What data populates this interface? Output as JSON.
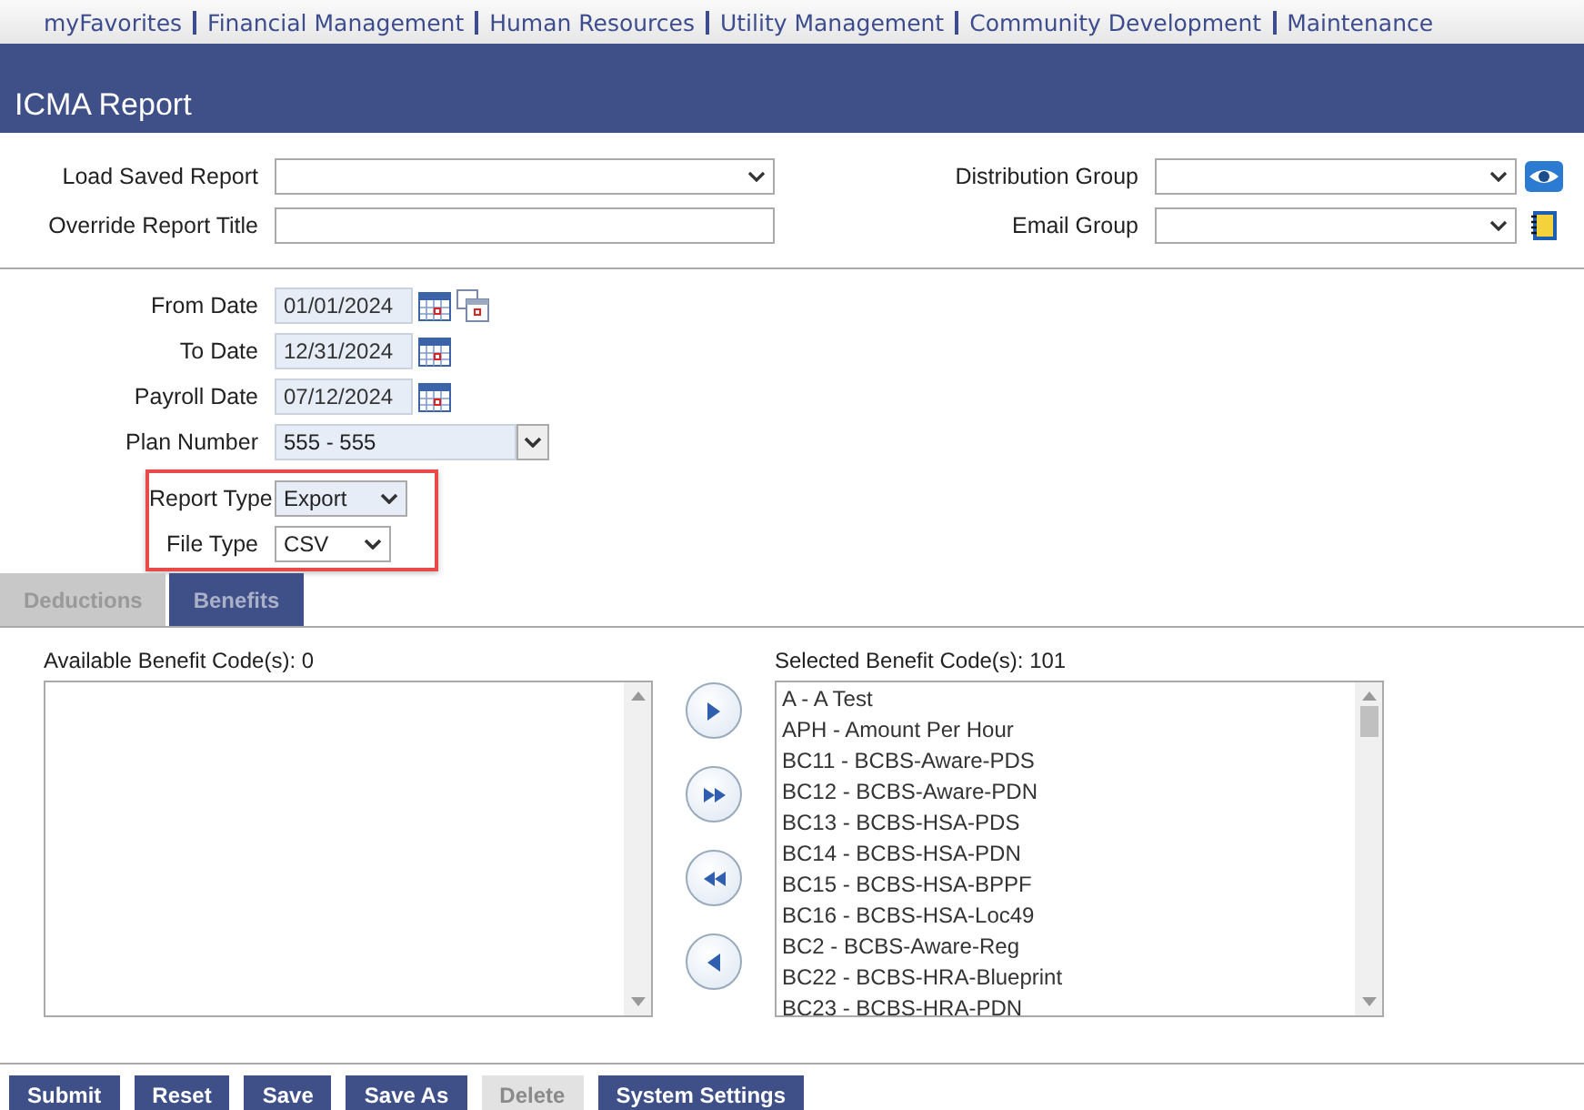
{
  "nav": [
    "myFavorites",
    "Financial Management",
    "Human Resources",
    "Utility Management",
    "Community Development",
    "Maintenance"
  ],
  "title": "ICMA Report",
  "top_left": [
    {
      "label": "Load Saved Report",
      "kind": "select"
    },
    {
      "label": "Override Report Title",
      "kind": "text"
    }
  ],
  "top_right": [
    {
      "label": "Distribution Group"
    },
    {
      "label": "Email Group"
    }
  ],
  "dates": [
    {
      "label": "From Date",
      "value": "01/01/2024"
    },
    {
      "label": "To Date",
      "value": "12/31/2024"
    },
    {
      "label": "Payroll Date",
      "value": "07/12/2024"
    }
  ],
  "plan": {
    "label": "Plan Number",
    "value": "555 - 555"
  },
  "highlighted": [
    {
      "label": "Report Type",
      "value": "Export"
    },
    {
      "label": "File Type",
      "value": "CSV"
    }
  ],
  "tabs": [
    {
      "label": "Deductions",
      "selected": false
    },
    {
      "label": "Benefits",
      "selected": true
    }
  ],
  "available": {
    "label": "Available Benefit Code(s): 0"
  },
  "selected_list": {
    "label": "Selected Benefit Code(s): 101",
    "items": [
      "A - A Test",
      "APH - Amount Per Hour",
      "BC11 - BCBS-Aware-PDS",
      "BC12 - BCBS-Aware-PDN",
      "BC13 - BCBS-HSA-PDS",
      "BC14 - BCBS-HSA-PDN",
      "BC15 - BCBS-HSA-BPPF",
      "BC16 - BCBS-HSA-Loc49",
      "BC2 - BCBS-Aware-Reg",
      "BC22 - BCBS-HRA-Blueprint",
      "BC23 - BCBS-HRA-PDN"
    ]
  },
  "move_buttons": [
    {
      "kind": "right"
    },
    {
      "kind": "all-right"
    },
    {
      "kind": "all-left"
    },
    {
      "kind": "left"
    }
  ],
  "buttons": [
    {
      "label": "Submit",
      "disabled": false
    },
    {
      "label": "Reset",
      "disabled": false
    },
    {
      "label": "Save",
      "disabled": false
    },
    {
      "label": "Save As",
      "disabled": false
    },
    {
      "label": "Delete",
      "disabled": true
    },
    {
      "label": "System Settings",
      "disabled": false
    }
  ]
}
